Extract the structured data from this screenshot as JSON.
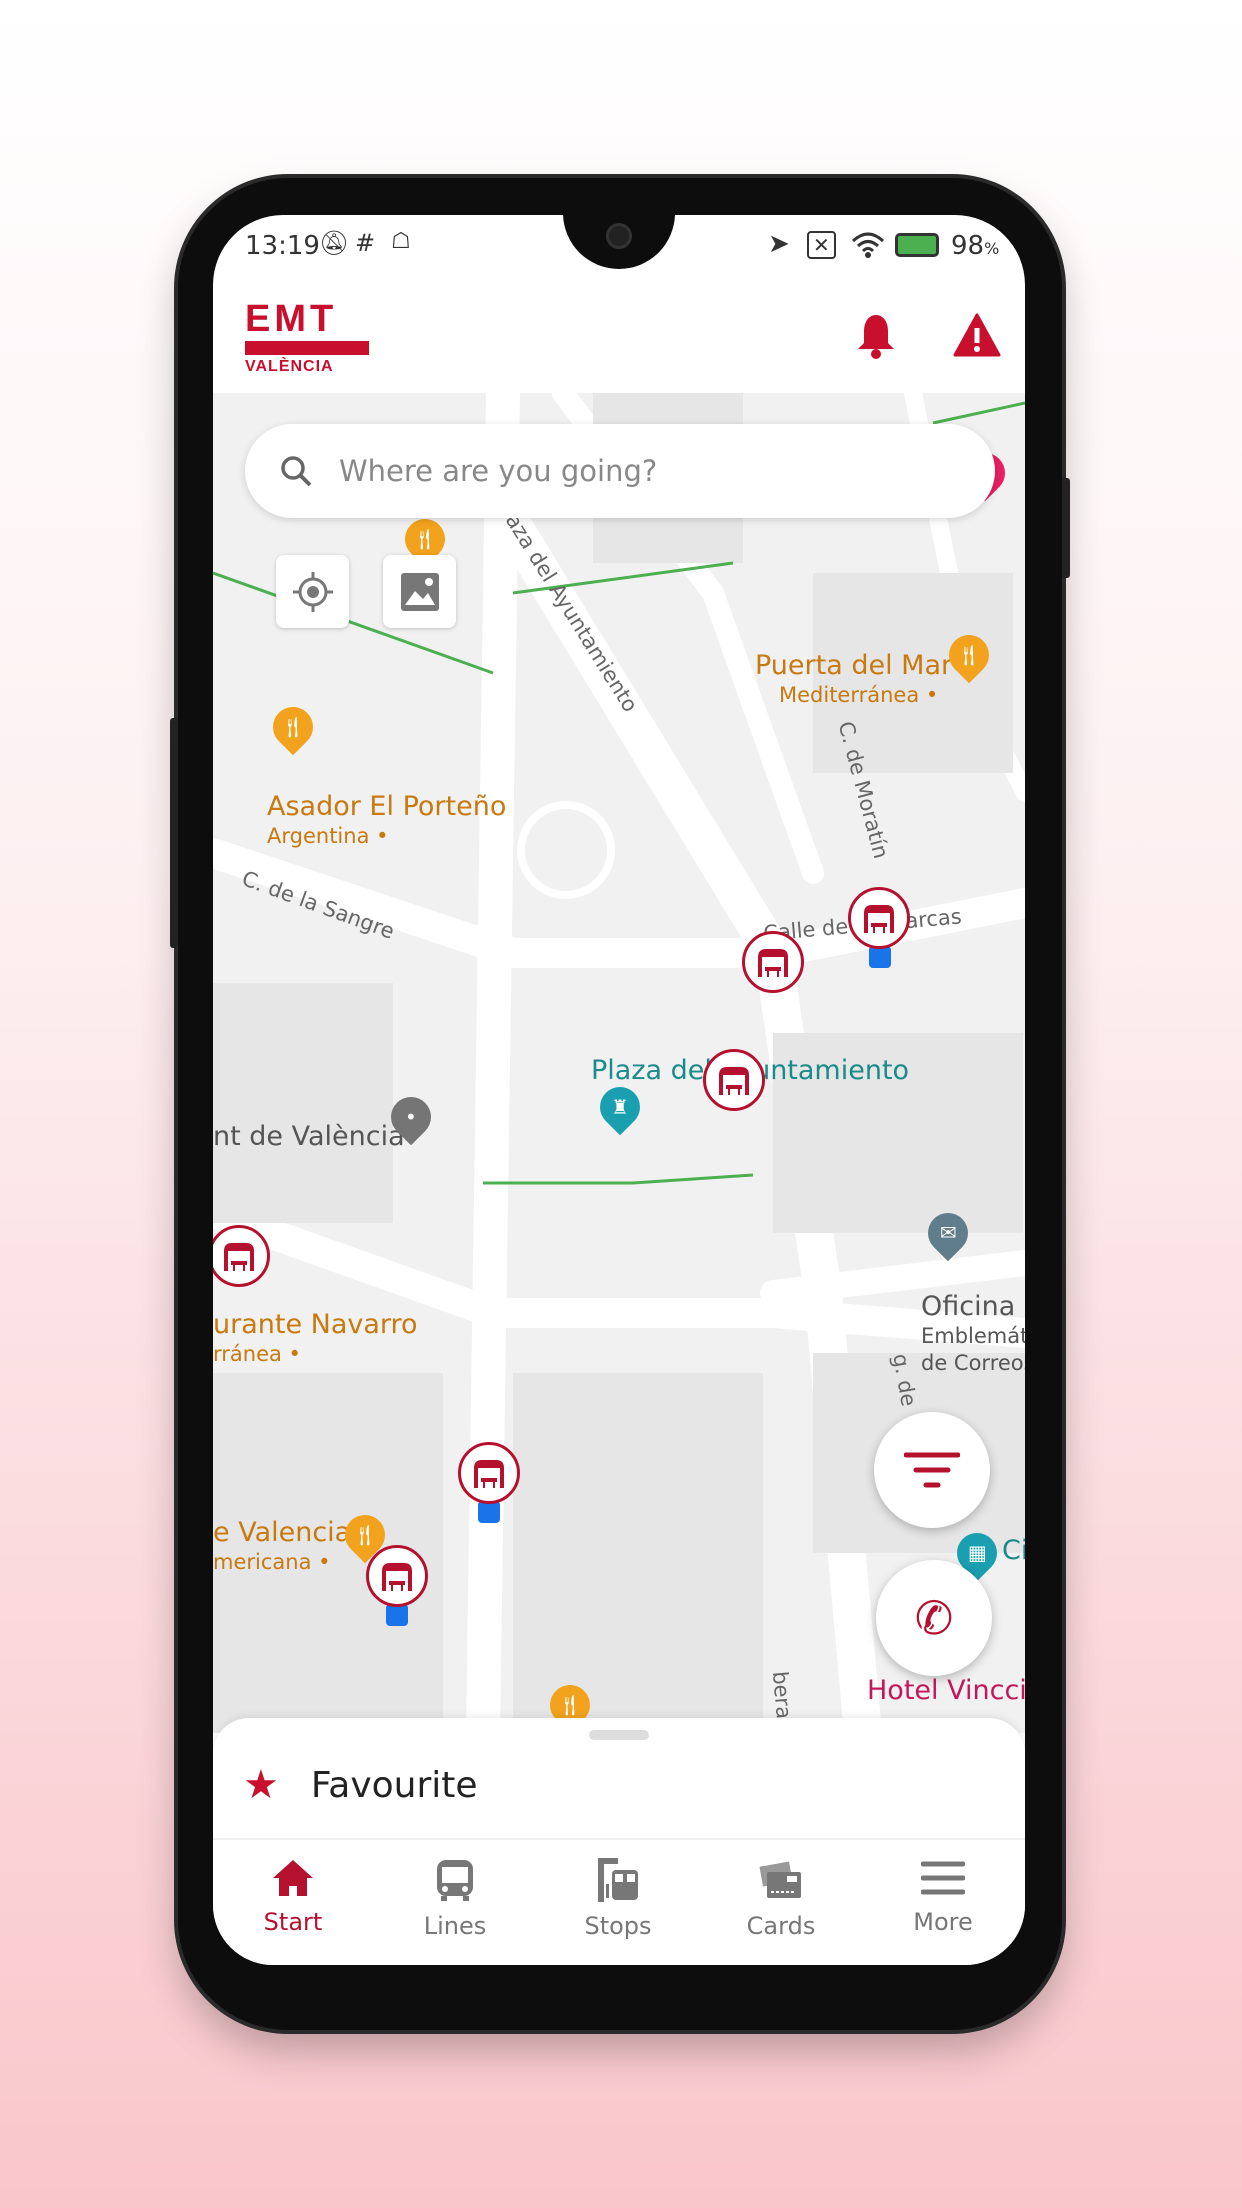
{
  "status_bar": {
    "time": "13:19",
    "battery": "98",
    "battery_unit": "%"
  },
  "header": {
    "logo_top": "EMT",
    "logo_bottom": "VALÈNCIA",
    "icons": [
      "bell-icon",
      "warning-icon"
    ]
  },
  "search": {
    "placeholder": "Where are you going?"
  },
  "map": {
    "places": [
      {
        "name": "Puerta del Mar",
        "sub": "Mediterránea •"
      },
      {
        "name": "Asador El Porteño",
        "sub": "Argentina •"
      },
      {
        "name": "Plaza del Ayuntamiento"
      },
      {
        "name": "nt de València"
      },
      {
        "name": "urante Navarro",
        "sub": "rránea •"
      },
      {
        "name": "Oficina d",
        "sub": "Emblemáti",
        "sub2": "de Correos"
      },
      {
        "name": "e Valencia",
        "sub": "mericana •"
      },
      {
        "name": "Hotel Vincci"
      },
      {
        "name": "Ci"
      }
    ],
    "streets": [
      "Plaza del Ayuntamiento",
      "C. de la Sangre",
      "C. de Moratín",
      "Calle de les Barcas",
      "g. de",
      "bera"
    ]
  },
  "colors": {
    "brand": "#b5102e",
    "restaurant": "#f2a21c",
    "landmark": "#1a8a8a",
    "hotel": "#c2185b"
  },
  "sheet": {
    "favourite_label": "Favourite"
  },
  "nav": [
    {
      "label": "Start",
      "active": true
    },
    {
      "label": "Lines"
    },
    {
      "label": "Stops"
    },
    {
      "label": "Cards"
    },
    {
      "label": "More"
    }
  ]
}
